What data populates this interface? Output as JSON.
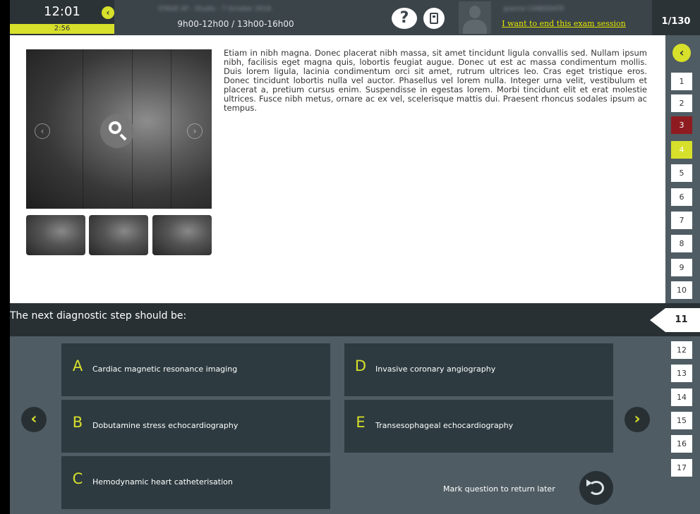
{
  "header": {
    "clock_time": "12:01",
    "time_remaining": "2:56",
    "session_name": "STAGE AF - Studio - 7 October 2016",
    "session_time": "9h00-12h00 / 13h00-16h00",
    "user_name": "Jeanne CANDIDATE",
    "end_session_label": "I want to end this exam session",
    "question_counter": "1/130",
    "help_icon": "question-help-icon",
    "calculator_icon": "calculator-icon"
  },
  "stem": {
    "text": "Etiam in nibh magna. Donec placerat nibh massa, sit amet tincidunt ligula convallis sed. Nullam ipsum nibh, facilisis eget magna quis, lobortis feugiat augue. Donec ut est ac massa condimentum mollis. Duis lorem ligula, lacinia condimentum orci sit amet, rutrum ultrices leo. Cras eget tristique eros. Donec tincidunt lobortis nulla vel auctor. Phasellus vel lorem nulla. Integer urna velit, vestibulum et placerat a, pretium cursus enim. Suspendisse in egestas lorem. Morbi tincidunt elit et erat molestie ultrices. Fusce nibh metus, ornare ac ex vel, scelerisque mattis dui. Praesent rhoncus sodales ipsum ac tempus."
  },
  "question": {
    "text": "The next diagnostic step should be:",
    "options": [
      {
        "letter": "A",
        "label": "Cardiac magnetic resonance imaging"
      },
      {
        "letter": "B",
        "label": "Dobutamine stress echocardiography"
      },
      {
        "letter": "C",
        "label": "Hemodynamic heart catheterisation"
      },
      {
        "letter": "D",
        "label": "Invasive coronary angiography"
      },
      {
        "letter": "E",
        "label": "Transesophageal echocardiography"
      }
    ],
    "mark_label": "Mark question to return later"
  },
  "navigator": {
    "back_symbol": "‹",
    "current": "11",
    "top_items": [
      "1",
      "2",
      "3",
      "4",
      "5",
      "6",
      "7",
      "8",
      "9",
      "10"
    ],
    "bottom_items": [
      "12",
      "13",
      "14",
      "15",
      "16",
      "17"
    ],
    "flagged_item": "3",
    "answered_item": "4"
  },
  "nav": {
    "prev_symbol": "‹",
    "next_symbol": "›"
  },
  "colors": {
    "header_bg": "#3b4449",
    "accent": "#d7e02a",
    "flagged": "#8e1b20",
    "option_bg": "#2d3a40",
    "answers_bg": "#4f5c63"
  }
}
